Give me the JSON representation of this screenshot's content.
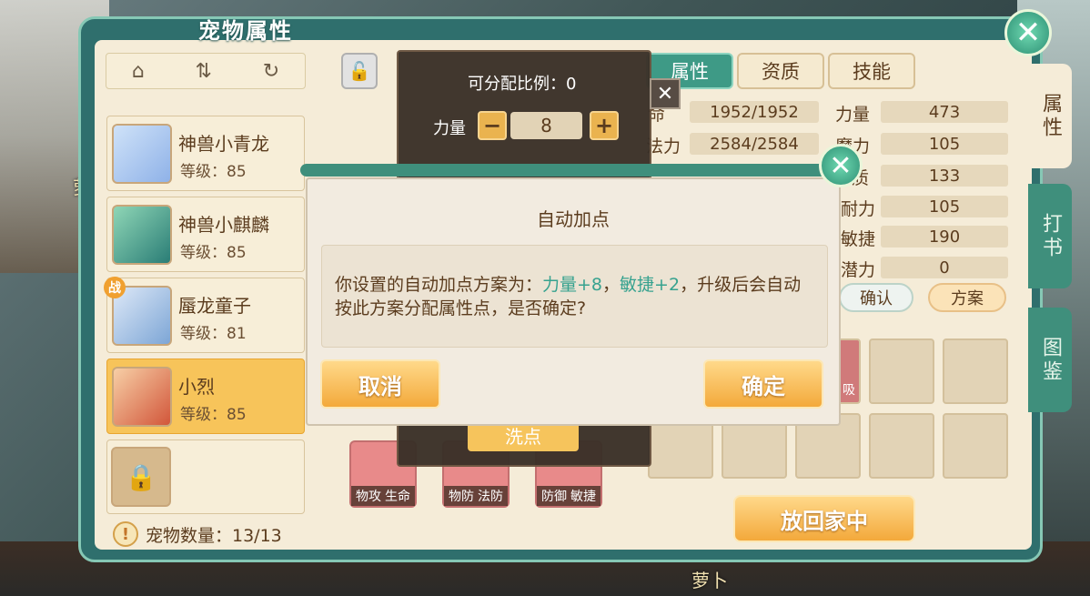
{
  "window": {
    "title": "宠物属性"
  },
  "background": {
    "left_label": "萝",
    "bottom_label": "萝卜"
  },
  "toolbar": {
    "home_icon": "⌂",
    "sort_icon": "⇅",
    "refresh_icon": "↻"
  },
  "pets": [
    {
      "name": "神兽小青龙",
      "level": "等级：85"
    },
    {
      "name": "神兽小麒麟",
      "level": "等级：85"
    },
    {
      "name": "蜃龙童子",
      "level": "等级：81",
      "badge": "战"
    },
    {
      "name": "小烈",
      "level": "等级：85"
    }
  ],
  "pet_count": "宠物数量：13/13",
  "tabs": [
    "属性",
    "资质",
    "技能"
  ],
  "side_tabs": [
    "属性",
    "打书",
    "图鉴"
  ],
  "stats_left": [
    {
      "label": "命",
      "value": "1952/1952"
    },
    {
      "label": "法力",
      "value": "2584/2584"
    }
  ],
  "stats_right": [
    {
      "label": "力量",
      "value": "473"
    },
    {
      "label": "魔力",
      "value": "105"
    },
    {
      "label": "质",
      "value": "133"
    },
    {
      "label": "耐力",
      "value": "105"
    },
    {
      "label": "敏捷",
      "value": "190"
    },
    {
      "label": "潜力",
      "value": "0"
    }
  ],
  "buttons": {
    "confirm_small": "确认",
    "scheme": "方案",
    "return_home": "放回家中",
    "wash": "洗点"
  },
  "equipment": [
    {
      "a": "物攻",
      "b": "生命"
    },
    {
      "a": "物防",
      "b": "法防"
    },
    {
      "a": "防御",
      "b": "敏捷"
    }
  ],
  "skill_slot_label": "吸",
  "alloc": {
    "ratio_label": "可分配比例：0",
    "stat_label": "力量",
    "stat_value": "8",
    "minus": "−",
    "plus": "+",
    "close": "✕"
  },
  "modal": {
    "title": "自动加点",
    "msg_pre": "你设置的自动加点方案为：",
    "msg_hl1": "力量+8",
    "msg_sep": "，",
    "msg_hl2": "敏捷+2",
    "msg_post": "，升级后会自动按此方案分配属性点，是否确定?",
    "cancel": "取消",
    "ok": "确定"
  },
  "colors": {
    "accent": "#3f8f7c",
    "highlight": "#37a28f",
    "button": "#f3a93b"
  }
}
